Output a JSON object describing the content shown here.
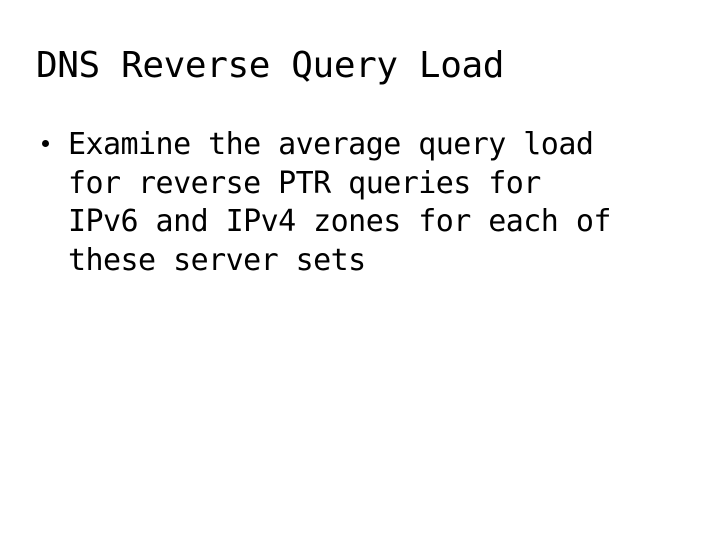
{
  "slide": {
    "background_color": "#ffffff",
    "text_color": "#000000",
    "title": "DNS Reverse Query Load",
    "bullets": [
      {
        "marker": "bullet-dot",
        "text": "Examine the average query load\nfor reverse PTR queries for\nIPv6 and IPv4 zones for each of\nthese server sets"
      }
    ]
  }
}
